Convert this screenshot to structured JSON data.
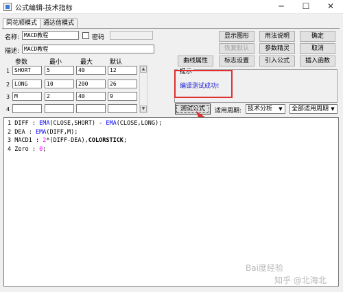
{
  "window": {
    "title": "公式编辑-技术指标",
    "controls": {
      "minimize": "─",
      "maximize": "☐",
      "close": "✕"
    }
  },
  "tabs": [
    {
      "label": "同花顺模式",
      "active": true
    },
    {
      "label": "通达信模式",
      "active": false
    }
  ],
  "form": {
    "name_label": "名称:",
    "name_value": "MACD教程",
    "password_label": "密码",
    "password_checked": false,
    "password_value": "",
    "desc_label": "描述:",
    "desc_value": "MACD教程"
  },
  "params": {
    "headers": {
      "name": "参数",
      "min": "最小",
      "max": "最大",
      "default": "默认"
    },
    "rows": [
      {
        "num": "1",
        "name": "SHORT",
        "min": "5",
        "max": "40",
        "default": "12"
      },
      {
        "num": "2",
        "name": "LONG",
        "min": "10",
        "max": "200",
        "default": "26"
      },
      {
        "num": "3",
        "name": "M",
        "min": "2",
        "max": "40",
        "default": "9"
      },
      {
        "num": "4",
        "name": "",
        "min": "",
        "max": "",
        "default": ""
      }
    ]
  },
  "buttons": {
    "show_graph": "显示图形",
    "usage": "用法说明",
    "ok": "确定",
    "restore_default": "恢复默认",
    "param_tuning": "参数精灵",
    "cancel": "取消",
    "curve_props": "曲线属性",
    "mark_settings": "标志设置",
    "import_formula": "引入公式",
    "insert_function": "插入函数",
    "test_formula": "测试公式"
  },
  "hint": {
    "title": "提示",
    "message": "编译测试成功!"
  },
  "period": {
    "label": "适用周期:",
    "category_value": "技术分析",
    "period_value": "全部适用周期"
  },
  "code": {
    "lines": [
      {
        "num": "1",
        "parts": [
          {
            "t": "DIFF : ",
            "c": "ln"
          },
          {
            "t": "EMA",
            "c": "kw"
          },
          {
            "t": "(CLOSE,SHORT) - ",
            "c": "ln"
          },
          {
            "t": "EMA",
            "c": "kw"
          },
          {
            "t": "(CLOSE,LONG);",
            "c": "ln"
          }
        ]
      },
      {
        "num": "2",
        "parts": [
          {
            "t": "DEA : ",
            "c": "ln"
          },
          {
            "t": "EMA",
            "c": "kw"
          },
          {
            "t": "(DIFF,M);",
            "c": "ln"
          }
        ]
      },
      {
        "num": "3",
        "parts": [
          {
            "t": "MACD1 : ",
            "c": "ln"
          },
          {
            "t": "2",
            "c": "num"
          },
          {
            "t": "*(DIFF-DEA),",
            "c": "ln"
          },
          {
            "t": "COLORSTICK",
            "c": "bold"
          },
          {
            "t": ";",
            "c": "ln"
          }
        ]
      },
      {
        "num": "4",
        "parts": [
          {
            "t": "Zero : ",
            "c": "ln"
          },
          {
            "t": "0",
            "c": "num"
          },
          {
            "t": ";",
            "c": "ln"
          }
        ]
      }
    ]
  },
  "watermarks": {
    "baidu": "Bai度经验",
    "zhihu": "知乎 @北海北"
  },
  "colors": {
    "annotation_red": "#e03030",
    "hint_blue": "#1a1ad6",
    "keyword_blue": "#0000ff",
    "number_magenta": "#ff00ff"
  }
}
